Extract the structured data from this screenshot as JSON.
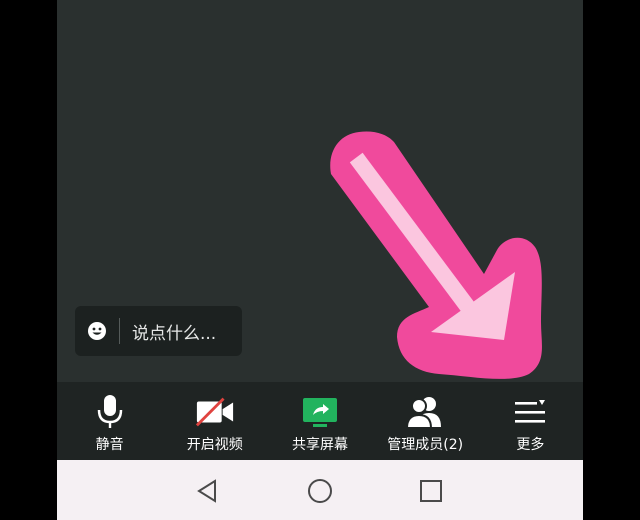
{
  "chat": {
    "placeholder": "说点什么..."
  },
  "toolbar": {
    "items": [
      {
        "label": "静音",
        "icon": "microphone-icon"
      },
      {
        "label": "开启视频",
        "icon": "video-off-icon"
      },
      {
        "label": "共享屏幕",
        "icon": "share-screen-icon"
      },
      {
        "label": "管理成员(2)",
        "icon": "members-icon"
      },
      {
        "label": "更多",
        "icon": "more-menu-icon"
      }
    ]
  },
  "navbar": {
    "buttons": [
      "back-icon",
      "home-icon",
      "recents-icon"
    ]
  },
  "colors": {
    "meeting_bg": "#2a302f",
    "toolbar_bg": "#1f2423",
    "share_green": "#22b35e",
    "arrow_pink": "#f04a9c",
    "arrow_light": "#fbc6df",
    "navbar_bg": "#f5f0f3"
  }
}
